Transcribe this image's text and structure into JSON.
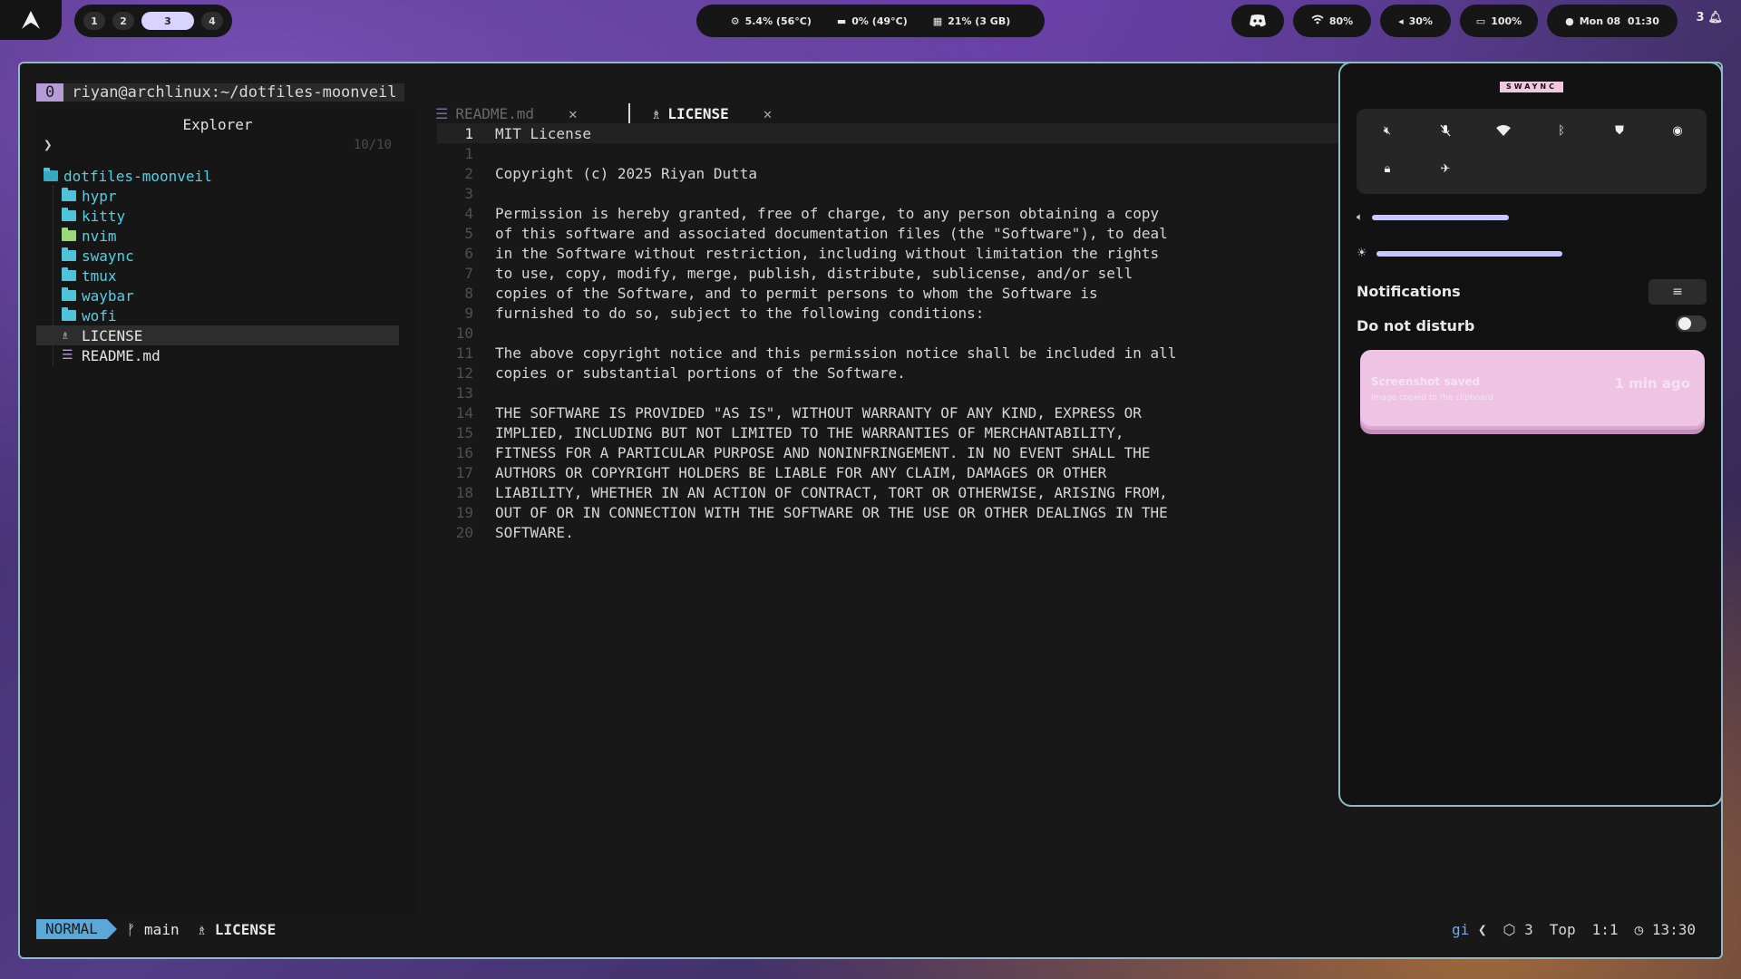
{
  "topbar": {
    "workspaces": [
      "1",
      "2",
      "3",
      "4"
    ],
    "active_workspace": "3",
    "cpu": "5.4% (56°C)",
    "gpu": "0% (49°C)",
    "memory": "21% (3 GB)",
    "wifi": "80%",
    "volume": "30%",
    "battery": "100%",
    "datetime": "Mon 08  01:30",
    "notif_count": "3"
  },
  "tmux": {
    "index": "0",
    "title": "riyan@archlinux:~/dotfiles-moonveil"
  },
  "explorer": {
    "title": "Explorer",
    "count": "10/10",
    "root": "dotfiles-moonveil",
    "items": [
      "hypr",
      "kitty",
      "nvim",
      "swaync",
      "tmux",
      "waybar",
      "wofi",
      "LICENSE",
      "README.md"
    ]
  },
  "tabs": [
    {
      "label": "README.md",
      "active": false
    },
    {
      "label": "LICENSE",
      "active": true
    }
  ],
  "editor": {
    "lines": [
      {
        "n": "1",
        "text": "MIT License"
      },
      {
        "n": "1",
        "text": ""
      },
      {
        "n": "2",
        "text": "Copyright (c) 2025 Riyan Dutta"
      },
      {
        "n": "3",
        "text": ""
      },
      {
        "n": "4",
        "text": "Permission is hereby granted, free of charge, to any person obtaining a copy"
      },
      {
        "n": "5",
        "text": "of this software and associated documentation files (the \"Software\"), to deal"
      },
      {
        "n": "6",
        "text": "in the Software without restriction, including without limitation the rights"
      },
      {
        "n": "7",
        "text": "to use, copy, modify, merge, publish, distribute, sublicense, and/or sell"
      },
      {
        "n": "8",
        "text": "copies of the Software, and to permit persons to whom the Software is"
      },
      {
        "n": "9",
        "text": "furnished to do so, subject to the following conditions:"
      },
      {
        "n": "10",
        "text": ""
      },
      {
        "n": "11",
        "text": "The above copyright notice and this permission notice shall be included in all"
      },
      {
        "n": "12",
        "text": "copies or substantial portions of the Software."
      },
      {
        "n": "13",
        "text": ""
      },
      {
        "n": "14",
        "text": "THE SOFTWARE IS PROVIDED \"AS IS\", WITHOUT WARRANTY OF ANY KIND, EXPRESS OR"
      },
      {
        "n": "15",
        "text": "IMPLIED, INCLUDING BUT NOT LIMITED TO THE WARRANTIES OF MERCHANTABILITY,"
      },
      {
        "n": "16",
        "text": "FITNESS FOR A PARTICULAR PURPOSE AND NONINFRINGEMENT. IN NO EVENT SHALL THE"
      },
      {
        "n": "17",
        "text": "AUTHORS OR COPYRIGHT HOLDERS BE LIABLE FOR ANY CLAIM, DAMAGES OR OTHER"
      },
      {
        "n": "18",
        "text": "LIABILITY, WHETHER IN AN ACTION OF CONTRACT, TORT OR OTHERWISE, ARISING FROM,"
      },
      {
        "n": "19",
        "text": "OUT OF OR IN CONNECTION WITH THE SOFTWARE OR THE USE OR OTHER DEALINGS IN THE"
      },
      {
        "n": "20",
        "text": "SOFTWARE."
      }
    ]
  },
  "status": {
    "mode": "NORMAL",
    "branch": "main",
    "file": "LICENSE",
    "gi": "gi",
    "pkg_count": "3",
    "scroll": "Top",
    "position": "1:1",
    "time": "13:30"
  },
  "swaync": {
    "logo": "SWAYNC",
    "volume_level": 0.42,
    "brightness_level": 0.9,
    "notifications_label": "Notifications",
    "dnd_label": "Do not disturb",
    "dnd_on": false,
    "notification": {
      "title": "Screenshot saved",
      "body": "Image copied to the clipboard",
      "age": "1 min ago"
    }
  }
}
